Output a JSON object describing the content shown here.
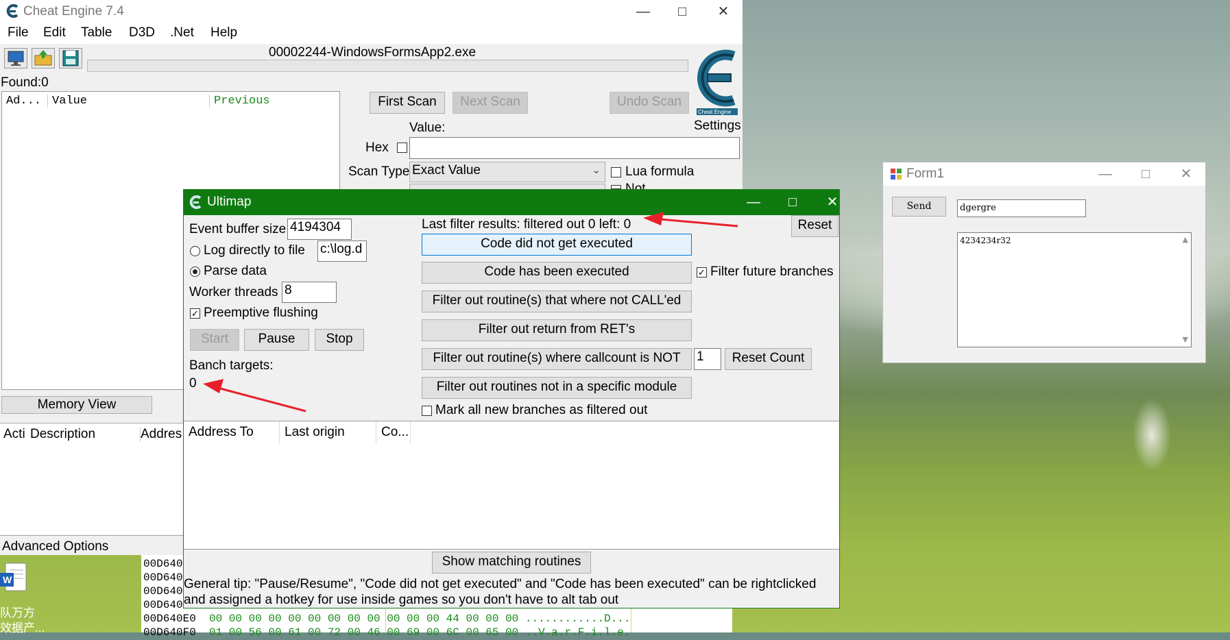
{
  "cheat_engine": {
    "title": "Cheat Engine 7.4",
    "menu": [
      "File",
      "Edit",
      "Table",
      "D3D",
      ".Net",
      "Help"
    ],
    "process_name": "00002244-WindowsFormsApp2.exe",
    "found": "Found:0",
    "address_columns": [
      "Ad...",
      "Value",
      "Previous"
    ],
    "first_scan": "First Scan",
    "next_scan": "Next Scan",
    "undo_scan": "Undo Scan",
    "settings": "Settings",
    "logo_caption": "Cheat Engine",
    "value_label": "Value:",
    "hex_label": "Hex",
    "scan_type_label": "Scan Type",
    "scan_type_value": "Exact Value",
    "lua_formula": "Lua formula",
    "not_label": "Not",
    "memory_view": "Memory View",
    "table_columns": [
      "Acti",
      "Description",
      "Addres"
    ],
    "advanced_options": "Advanced Options",
    "hex_addresses": [
      "00D640",
      "00D640",
      "00D640",
      "00D640",
      "00D640E0",
      "00D640F0"
    ],
    "hex_row_e0": "00 00 00 00 00 00 00 00  00 00 00 00 44 00 00 00  ............D...",
    "hex_row_f0": "01 00 56 00 61 00 72 00  46 00 69 00 6C 00 65 00  ..V.a.r.F.i.l.e."
  },
  "ultimap": {
    "title": "Ultimap",
    "event_buffer_label": "Event buffer size",
    "event_buffer_value": "4194304",
    "log_directly_label": "Log directly to file",
    "log_path": "c:\\log.d",
    "parse_data_label": "Parse data",
    "worker_threads_label": "Worker threads",
    "worker_threads_value": "8",
    "preemptive_flushing": "Preemptive flushing",
    "start": "Start",
    "pause": "Pause",
    "stop": "Stop",
    "branch_targets_label": "Banch targets:",
    "branch_targets_value": "0",
    "last_filter_results": "Last filter results: filtered out 0 left: 0",
    "reset": "Reset",
    "code_not_executed": "Code did not get executed",
    "code_executed": "Code has been executed",
    "filter_future_branches": "Filter future branches",
    "filter_not_called": "Filter out routine(s) that where not CALL'ed",
    "filter_ret": "Filter out return from RET's",
    "filter_callcount": "Filter out routine(s) where callcount is NOT",
    "callcount_value": "1",
    "reset_count": "Reset Count",
    "filter_module": "Filter out routines not in a specific module",
    "mark_all_filtered": "Mark all new branches as filtered out",
    "columns": [
      "Address To",
      "Last origin",
      "Co..."
    ],
    "show_matching": "Show matching routines",
    "tip_line1": "General tip: \"Pause/Resume\", \"Code did not get executed\" and \"Code has been executed\" can be rightclicked",
    "tip_line2": "and assigned a hotkey for use inside games so you don't have to alt tab out"
  },
  "form1": {
    "title": "Form1",
    "send": "Send",
    "input_value": "dgergre",
    "textarea_value": "4234234r32"
  },
  "desktop": {
    "icon_label_1": "队万方",
    "icon_label_2": "效据产..."
  },
  "colors": {
    "ultimap_title": "#0f7a10",
    "annotation_arrow": "#e8202a",
    "previous_column": "#1a8a1a"
  }
}
